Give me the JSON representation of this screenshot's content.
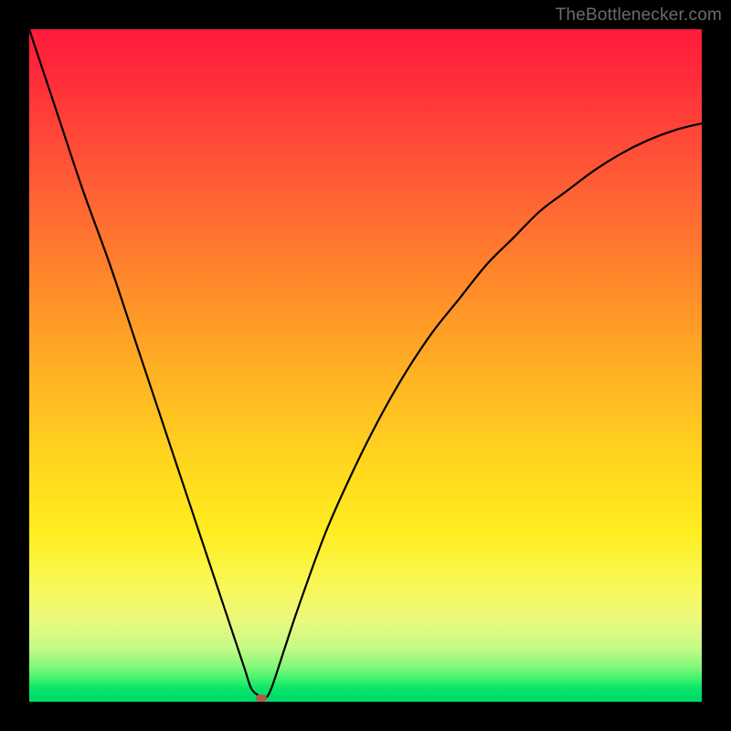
{
  "brand": {
    "credit": "TheBottlenecker.com"
  },
  "chart_data": {
    "type": "line",
    "title": "",
    "xlabel": "",
    "ylabel": "",
    "xlim": [
      0,
      100
    ],
    "ylim": [
      0,
      100
    ],
    "x": [
      0,
      4,
      8,
      12,
      16,
      20,
      24,
      28,
      30,
      32,
      33,
      34,
      35,
      36,
      38,
      40,
      44,
      48,
      52,
      56,
      60,
      64,
      68,
      72,
      76,
      80,
      84,
      88,
      92,
      96,
      100
    ],
    "values": [
      100,
      88,
      76,
      65,
      53,
      41,
      29,
      17,
      11,
      5,
      2,
      1,
      0.5,
      2,
      8,
      14,
      25,
      34,
      42,
      49,
      55,
      60,
      65,
      69,
      73,
      76,
      79,
      81.5,
      83.5,
      85,
      86
    ],
    "marker": {
      "x": 34.5,
      "y": 0.5
    },
    "legend": false,
    "grid": false
  },
  "colors": {
    "curve": "#000000",
    "marker": "#b35a4a",
    "frame": "#000000"
  }
}
